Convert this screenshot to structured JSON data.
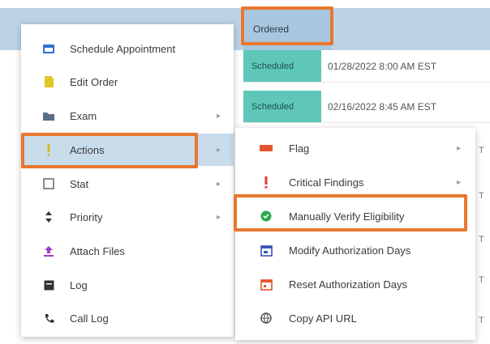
{
  "grid": {
    "status_header": "Ordered",
    "rows": [
      {
        "status": "Scheduled",
        "date": "01/28/2022 8:00 AM EST"
      },
      {
        "status": "Scheduled",
        "date": "02/16/2022 8:45 AM EST"
      }
    ],
    "edge_letters": [
      "T",
      "T",
      "T",
      "T",
      "T"
    ]
  },
  "menu": {
    "items": [
      {
        "label": "Schedule Appointment",
        "icon": "calendar-icon",
        "color": "#2f6fd6",
        "submenu": false
      },
      {
        "label": "Edit Order",
        "icon": "document-icon",
        "color": "#e1c72a",
        "submenu": false
      },
      {
        "label": "Exam",
        "icon": "folder-icon",
        "color": "#5b6f85",
        "submenu": true
      },
      {
        "label": "Actions",
        "icon": "exclamation-icon",
        "color": "#d9b628",
        "submenu": true
      },
      {
        "label": "Stat",
        "icon": "checkbox-icon",
        "color": "#666666",
        "submenu": true
      },
      {
        "label": "Priority",
        "icon": "sort-icon",
        "color": "#333333",
        "submenu": true
      },
      {
        "label": "Attach Files",
        "icon": "upload-icon",
        "color": "#a23bc4",
        "submenu": false
      },
      {
        "label": "Log",
        "icon": "log-icon",
        "color": "#333333",
        "submenu": false
      },
      {
        "label": "Call Log",
        "icon": "phone-icon",
        "color": "#333333",
        "submenu": false
      }
    ]
  },
  "submenu": {
    "items": [
      {
        "label": "Flag",
        "icon": "flag-icon",
        "color": "#e5542c",
        "submenu": true
      },
      {
        "label": "Critical Findings",
        "icon": "exclamation-icon",
        "color": "#e03a2e",
        "submenu": true
      },
      {
        "label": "Manually Verify Eligibility",
        "icon": "check-circle-icon",
        "color": "#2aa84a",
        "submenu": false
      },
      {
        "label": "Modify Authorization Days",
        "icon": "calendar-edit-icon",
        "color": "#3a55b8",
        "submenu": false
      },
      {
        "label": "Reset Authorization Days",
        "icon": "calendar-reset-icon",
        "color": "#e5542c",
        "submenu": false
      },
      {
        "label": "Copy API URL",
        "icon": "globe-icon",
        "color": "#555555",
        "submenu": false
      }
    ]
  },
  "highlight_color": "#e8772e"
}
